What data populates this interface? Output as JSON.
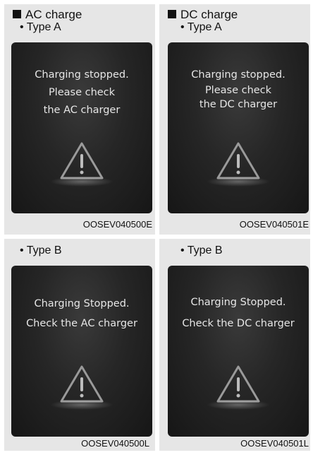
{
  "sections": {
    "ac": {
      "heading": "AC charge"
    },
    "dc": {
      "heading": "DC charge"
    }
  },
  "panels": [
    {
      "type_label": "• Type A",
      "lines": [
        "Charging stopped.",
        "Please check",
        "the AC charger"
      ],
      "code": "OOSEV040500E"
    },
    {
      "type_label": "• Type A",
      "lines": [
        "Charging stopped.",
        "Please check",
        "the DC charger"
      ],
      "code": "OOSEV040501E"
    },
    {
      "type_label": "• Type B",
      "lines": [
        "Charging Stopped.",
        "Check the AC charger"
      ],
      "code": "OOSEV040500L"
    },
    {
      "type_label": "• Type B",
      "lines": [
        "Charging Stopped.",
        "Check the DC charger"
      ],
      "code": "OOSEV040501L"
    }
  ],
  "icons": {
    "warning": "warning-triangle-icon"
  }
}
